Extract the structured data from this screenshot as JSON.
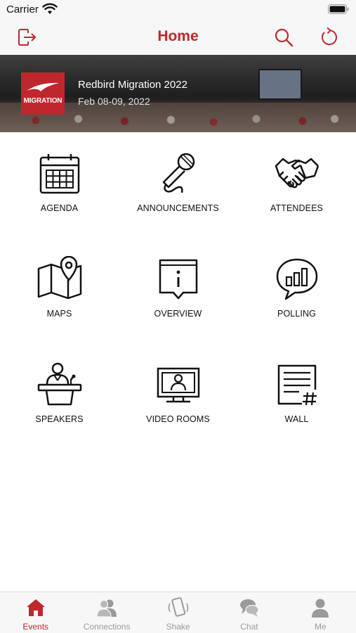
{
  "status_bar": {
    "carrier": "Carrier"
  },
  "nav": {
    "title": "Home",
    "left_icon": "exit-icon",
    "right_icons": [
      "search-icon",
      "refresh-icon"
    ],
    "accent_color": "#c0272d"
  },
  "event": {
    "logo_text": "MIGRATION",
    "name": "Redbird Migration 2022",
    "dates": "Feb 08-09, 2022"
  },
  "tiles": [
    {
      "label": "AGENDA",
      "icon": "calendar-icon"
    },
    {
      "label": "ANNOUNCEMENTS",
      "icon": "microphone-icon"
    },
    {
      "label": "ATTENDEES",
      "icon": "handshake-icon"
    },
    {
      "label": "MAPS",
      "icon": "map-pin-icon"
    },
    {
      "label": "OVERVIEW",
      "icon": "info-icon"
    },
    {
      "label": "POLLING",
      "icon": "poll-chart-icon"
    },
    {
      "label": "SPEAKERS",
      "icon": "podium-speaker-icon"
    },
    {
      "label": "VIDEO ROOMS",
      "icon": "video-monitor-icon"
    },
    {
      "label": "WALL",
      "icon": "wall-post-icon"
    }
  ],
  "tab_bar": {
    "active": "Events",
    "tabs": [
      {
        "label": "Events",
        "icon": "home-icon"
      },
      {
        "label": "Connections",
        "icon": "people-icon"
      },
      {
        "label": "Shake",
        "icon": "shake-phone-icon"
      },
      {
        "label": "Chat",
        "icon": "chat-bubbles-icon"
      },
      {
        "label": "Me",
        "icon": "person-icon"
      }
    ]
  }
}
